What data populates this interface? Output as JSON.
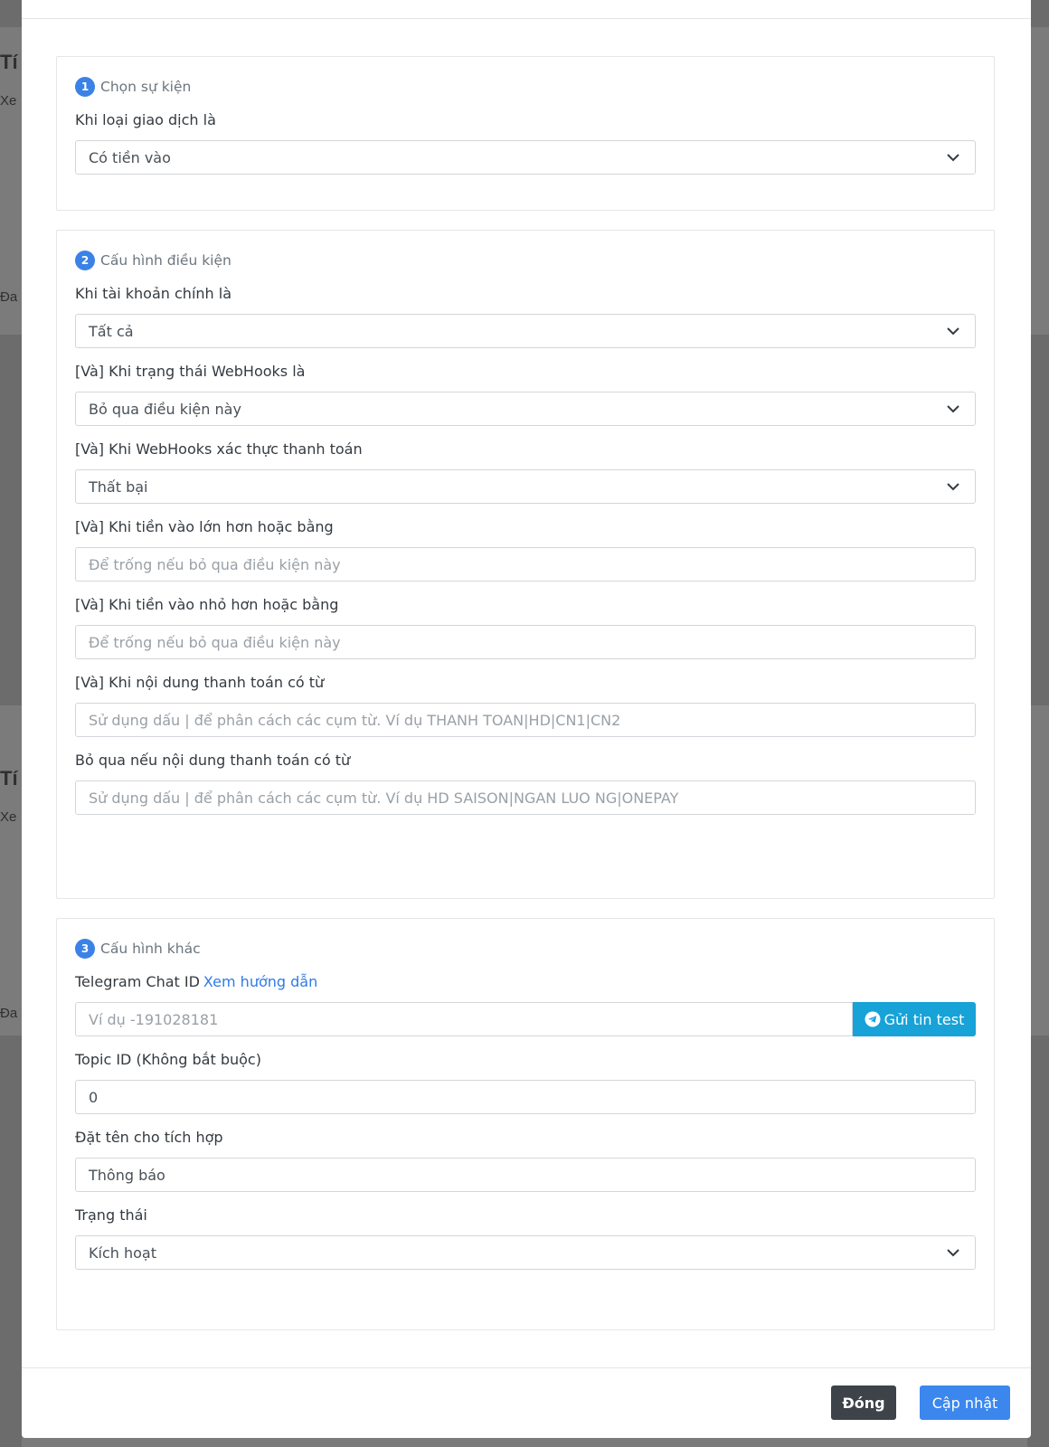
{
  "sections": [
    {
      "number": "1",
      "title": "Chọn sự kiện",
      "fields": [
        {
          "label": "Khi loại giao dịch là",
          "value": "Có tiền vào"
        }
      ]
    },
    {
      "number": "2",
      "title": "Cấu hình điều kiện",
      "fields": [
        {
          "label": "Khi tài khoản chính là",
          "value": "Tất cả"
        },
        {
          "label": "[Và] Khi trạng thái WebHooks là",
          "value": "Bỏ qua điều kiện này"
        },
        {
          "label": "[Và] Khi WebHooks xác thực thanh toán",
          "value": "Thất bại"
        },
        {
          "label": "[Và] Khi tiền vào lớn hơn hoặc bằng",
          "placeholder": "Để trống nếu bỏ qua điều kiện này"
        },
        {
          "label": "[Và] Khi tiền vào nhỏ hơn hoặc bằng",
          "placeholder": "Để trống nếu bỏ qua điều kiện này"
        },
        {
          "label": "[Và] Khi nội dung thanh toán có từ",
          "placeholder": "Sử dụng dấu | để phân cách các cụm từ. Ví dụ THANH TOAN|HD|CN1|CN2"
        },
        {
          "label": "Bỏ qua nếu nội dung thanh toán có từ",
          "placeholder": "Sử dụng dấu | để phân cách các cụm từ. Ví dụ HD SAISON|NGAN LUO NG|ONEPAY"
        }
      ]
    },
    {
      "number": "3",
      "title": "Cấu hình khác",
      "telegram": {
        "label": "Telegram Chat ID",
        "link": "Xem hướng dẫn",
        "placeholder": "Ví dụ -191028181",
        "button": "Gửi tin test"
      },
      "fields": [
        {
          "label": "Topic ID (Không bắt buộc)",
          "value": "0"
        },
        {
          "label": "Đặt tên cho tích hợp",
          "value": "Thông báo"
        },
        {
          "label": "Trạng thái",
          "value": "Kích hoạt"
        }
      ]
    }
  ],
  "footer": {
    "close_label": "Đóng",
    "update_label": "Cập nhật"
  },
  "background": {
    "frag_1": "Tí",
    "frag_2": "Xe",
    "frag_3": "Đa",
    "frag_4": "Tí",
    "frag_5": "Xe",
    "frag_6": "Đa"
  },
  "colors": {
    "primary": "#3b87ee",
    "info": "#17a2d8",
    "secondary": "#3d4349",
    "badge": "#3b82e6"
  }
}
